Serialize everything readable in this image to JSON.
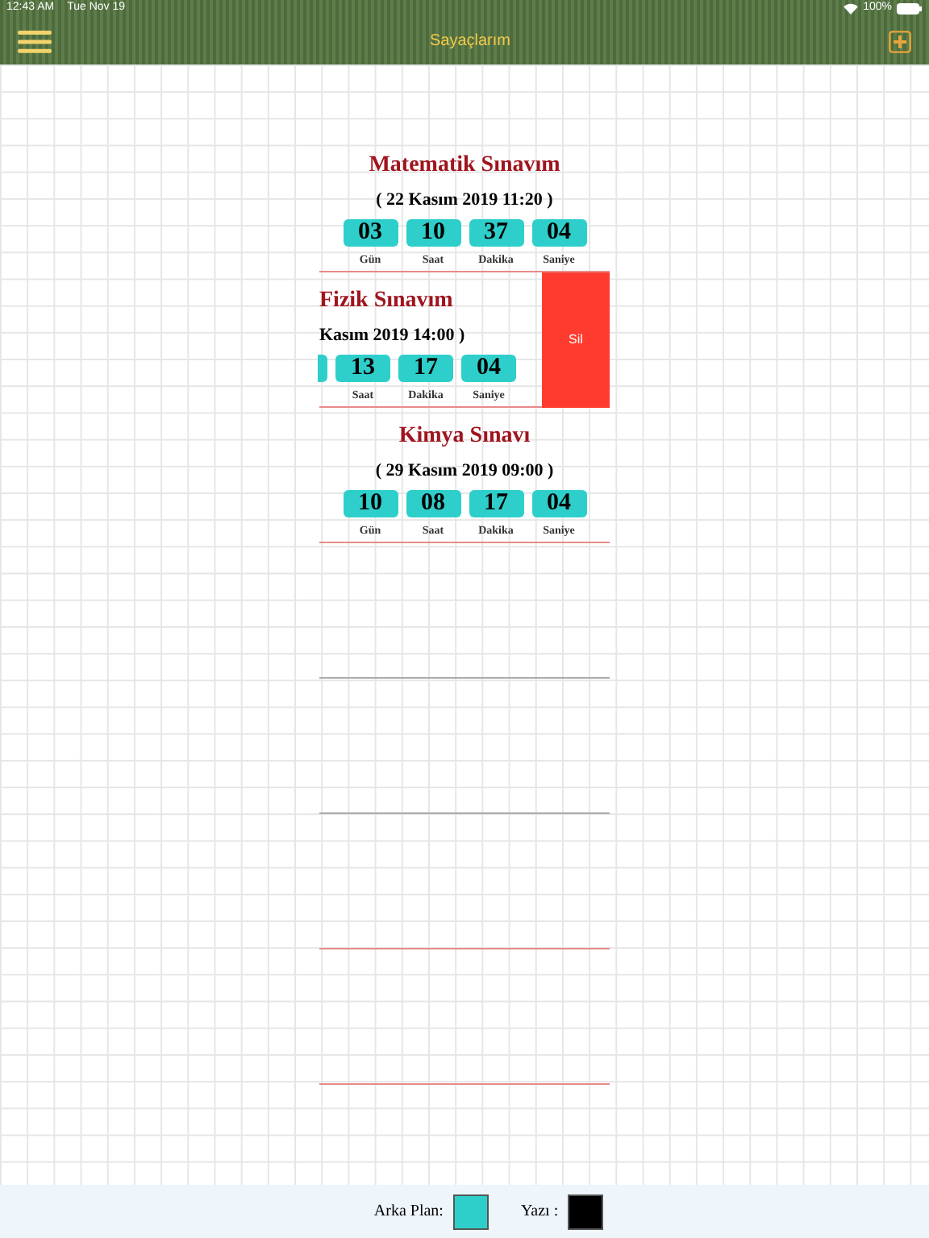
{
  "status_bar": {
    "time": "12:43 AM",
    "date": "Tue Nov 19",
    "battery": "100%"
  },
  "nav_bar": {
    "title": "Sayaçlarım"
  },
  "counters": [
    {
      "title": "Matematik Sınavım",
      "date": "( 22 Kasım 2019 11:20 )",
      "swiped": false,
      "units": [
        {
          "value": "03",
          "label": "Gün"
        },
        {
          "value": "10",
          "label": "Saat"
        },
        {
          "value": "37",
          "label": "Dakika"
        },
        {
          "value": "04",
          "label": "Saniye"
        }
      ]
    },
    {
      "title": "Fizik Sınavım",
      "date": "Kasım 2019 14:00 )",
      "swiped": true,
      "delete_label": "Sil",
      "units": [
        {
          "value": "13",
          "label": "Saat"
        },
        {
          "value": "17",
          "label": "Dakika"
        },
        {
          "value": "04",
          "label": "Saniye"
        }
      ]
    },
    {
      "title": "Kimya Sınavı",
      "date": "( 29 Kasım 2019 09:00 )",
      "swiped": false,
      "units": [
        {
          "value": "10",
          "label": "Gün"
        },
        {
          "value": "08",
          "label": "Saat"
        },
        {
          "value": "17",
          "label": "Dakika"
        },
        {
          "value": "04",
          "label": "Saniye"
        }
      ]
    }
  ],
  "footer": {
    "settings": [
      {
        "label": "Arka Plan:",
        "color": "#2ecfcb"
      },
      {
        "label": "Yazı :",
        "color": "#000000"
      }
    ]
  }
}
